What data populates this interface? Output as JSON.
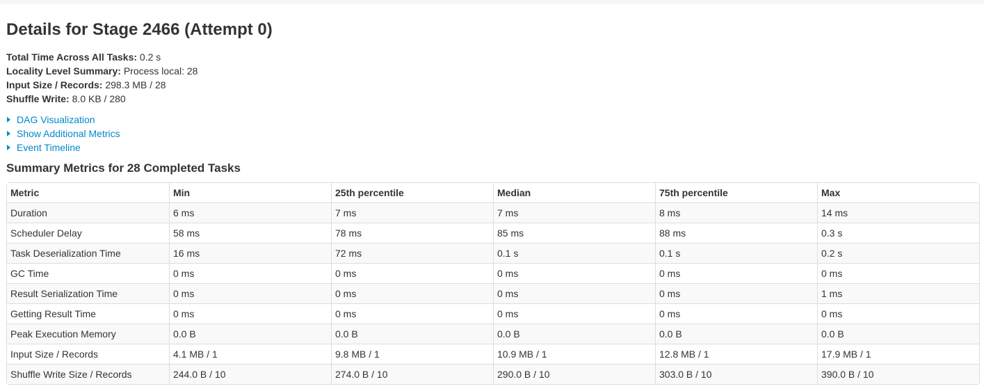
{
  "page": {
    "title": "Details for Stage 2466 (Attempt 0)"
  },
  "summary": {
    "total_time": {
      "label": "Total Time Across All Tasks:",
      "value": "0.2 s"
    },
    "locality": {
      "label": "Locality Level Summary:",
      "value": "Process local: 28"
    },
    "input": {
      "label": "Input Size / Records:",
      "value": "298.3 MB / 28"
    },
    "shuffle_write": {
      "label": "Shuffle Write:",
      "value": "8.0 KB / 280"
    }
  },
  "toggles": {
    "dag": "DAG Visualization",
    "additional_metrics": "Show Additional Metrics",
    "event_timeline": "Event Timeline"
  },
  "metrics": {
    "title": "Summary Metrics for 28 Completed Tasks",
    "headers": [
      "Metric",
      "Min",
      "25th percentile",
      "Median",
      "75th percentile",
      "Max"
    ],
    "rows": [
      [
        "Duration",
        "6 ms",
        "7 ms",
        "7 ms",
        "8 ms",
        "14 ms"
      ],
      [
        "Scheduler Delay",
        "58 ms",
        "78 ms",
        "85 ms",
        "88 ms",
        "0.3 s"
      ],
      [
        "Task Deserialization Time",
        "16 ms",
        "72 ms",
        "0.1 s",
        "0.1 s",
        "0.2 s"
      ],
      [
        "GC Time",
        "0 ms",
        "0 ms",
        "0 ms",
        "0 ms",
        "0 ms"
      ],
      [
        "Result Serialization Time",
        "0 ms",
        "0 ms",
        "0 ms",
        "0 ms",
        "1 ms"
      ],
      [
        "Getting Result Time",
        "0 ms",
        "0 ms",
        "0 ms",
        "0 ms",
        "0 ms"
      ],
      [
        "Peak Execution Memory",
        "0.0 B",
        "0.0 B",
        "0.0 B",
        "0.0 B",
        "0.0 B"
      ],
      [
        "Input Size / Records",
        "4.1 MB / 1",
        "9.8 MB / 1",
        "10.9 MB / 1",
        "12.8 MB / 1",
        "17.9 MB / 1"
      ],
      [
        "Shuffle Write Size / Records",
        "244.0 B / 10",
        "274.0 B / 10",
        "290.0 B / 10",
        "303.0 B / 10",
        "390.0 B / 10"
      ]
    ]
  },
  "colors": {
    "link": "#0088cc",
    "text": "#333333",
    "border": "#dddddd",
    "stripe": "#f9f9f9"
  }
}
